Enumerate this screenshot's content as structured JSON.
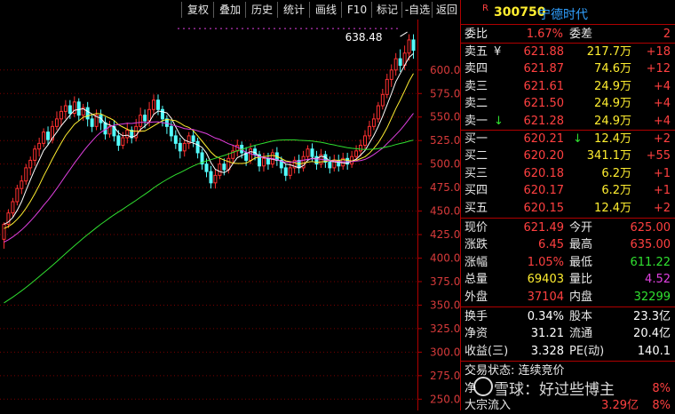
{
  "toolbar": {
    "buttons": [
      "复权",
      "叠加",
      "历史",
      "统计",
      "画线",
      "F10",
      "标记",
      "-自选",
      "返回"
    ]
  },
  "header": {
    "badge": "R",
    "code": "300750",
    "name": "宁德时代"
  },
  "chart_data": {
    "type": "candlestick",
    "y_axis": {
      "ticks": [
        600.0,
        575.0,
        550.0,
        525.0,
        500.0,
        475.0,
        450.0,
        425.0,
        400.0,
        375.0,
        350.0,
        325.0,
        300.0,
        275.0,
        250.0
      ],
      "labels": [
        "600.0",
        "575.0",
        "550.0",
        "525.0",
        "500.0",
        "475.0",
        "450.0",
        "425.0",
        "400.0",
        "375.0",
        "350.0",
        "325.0",
        "300.0",
        "275.0",
        "250.0"
      ],
      "min": 238,
      "max": 648
    },
    "max_annotation": {
      "label": "638.48",
      "value": 638.48
    },
    "candles": [
      [
        420,
        436,
        410,
        438
      ],
      [
        436,
        448,
        432,
        452
      ],
      [
        448,
        460,
        444,
        464
      ],
      [
        460,
        474,
        456,
        478
      ],
      [
        474,
        482,
        468,
        488
      ],
      [
        482,
        496,
        478,
        500
      ],
      [
        496,
        504,
        488,
        508
      ],
      [
        504,
        516,
        498,
        520
      ],
      [
        516,
        522,
        508,
        528
      ],
      [
        522,
        534,
        518,
        538
      ],
      [
        534,
        526,
        520,
        540
      ],
      [
        526,
        540,
        522,
        546
      ],
      [
        540,
        548,
        536,
        556
      ],
      [
        548,
        556,
        540,
        562
      ],
      [
        556,
        562,
        548,
        568
      ],
      [
        562,
        554,
        548,
        568
      ],
      [
        554,
        566,
        550,
        572
      ],
      [
        566,
        552,
        546,
        570
      ],
      [
        552,
        560,
        546,
        564
      ],
      [
        560,
        548,
        540,
        566
      ],
      [
        548,
        540,
        534,
        552
      ],
      [
        540,
        552,
        536,
        558
      ],
      [
        552,
        544,
        536,
        558
      ],
      [
        544,
        532,
        526,
        550
      ],
      [
        532,
        540,
        528,
        546
      ],
      [
        540,
        530,
        524,
        546
      ],
      [
        530,
        520,
        514,
        536
      ],
      [
        520,
        528,
        516,
        534
      ],
      [
        528,
        536,
        522,
        544
      ],
      [
        536,
        528,
        522,
        540
      ],
      [
        528,
        540,
        524,
        548
      ],
      [
        540,
        552,
        534,
        560
      ],
      [
        552,
        546,
        538,
        558
      ],
      [
        546,
        558,
        540,
        566
      ],
      [
        558,
        568,
        552,
        574
      ],
      [
        568,
        558,
        552,
        574
      ],
      [
        558,
        548,
        540,
        562
      ],
      [
        548,
        540,
        532,
        552
      ],
      [
        540,
        530,
        524,
        546
      ],
      [
        530,
        522,
        516,
        536
      ],
      [
        522,
        514,
        506,
        528
      ],
      [
        514,
        522,
        508,
        526
      ],
      [
        522,
        530,
        516,
        534
      ],
      [
        530,
        524,
        518,
        536
      ],
      [
        524,
        512,
        506,
        528
      ],
      [
        512,
        500,
        494,
        516
      ],
      [
        500,
        492,
        486,
        506
      ],
      [
        492,
        480,
        474,
        498
      ],
      [
        480,
        488,
        474,
        494
      ],
      [
        488,
        500,
        484,
        506
      ],
      [
        500,
        494,
        488,
        506
      ],
      [
        494,
        506,
        490,
        512
      ],
      [
        506,
        514,
        500,
        520
      ],
      [
        514,
        520,
        508,
        526
      ],
      [
        520,
        512,
        506,
        524
      ],
      [
        512,
        504,
        498,
        518
      ],
      [
        504,
        516,
        500,
        522
      ],
      [
        516,
        510,
        504,
        520
      ],
      [
        510,
        498,
        492,
        514
      ],
      [
        498,
        506,
        492,
        512
      ],
      [
        506,
        500,
        494,
        512
      ],
      [
        500,
        512,
        496,
        516
      ],
      [
        512,
        504,
        498,
        518
      ],
      [
        504,
        496,
        490,
        508
      ],
      [
        496,
        488,
        482,
        500
      ],
      [
        488,
        496,
        484,
        502
      ],
      [
        496,
        504,
        490,
        508
      ],
      [
        504,
        496,
        490,
        510
      ],
      [
        496,
        508,
        492,
        514
      ],
      [
        508,
        516,
        504,
        520
      ],
      [
        516,
        508,
        502,
        522
      ],
      [
        508,
        500,
        494,
        514
      ],
      [
        500,
        510,
        496,
        516
      ],
      [
        510,
        502,
        496,
        514
      ],
      [
        502,
        496,
        490,
        508
      ],
      [
        496,
        504,
        492,
        510
      ],
      [
        504,
        498,
        492,
        510
      ],
      [
        498,
        506,
        494,
        512
      ],
      [
        506,
        500,
        494,
        512
      ],
      [
        500,
        508,
        496,
        514
      ],
      [
        508,
        514,
        504,
        520
      ],
      [
        514,
        520,
        508,
        526
      ],
      [
        520,
        530,
        516,
        536
      ],
      [
        530,
        540,
        526,
        546
      ],
      [
        540,
        548,
        536,
        554
      ],
      [
        548,
        562,
        544,
        566
      ],
      [
        562,
        574,
        558,
        580
      ],
      [
        574,
        590,
        570,
        596
      ],
      [
        590,
        600,
        582,
        606
      ],
      [
        600,
        612,
        594,
        618
      ],
      [
        612,
        605,
        598,
        622
      ],
      [
        605,
        618,
        600,
        626
      ],
      [
        618,
        632,
        610,
        638
      ],
      [
        632,
        621,
        612,
        638
      ]
    ],
    "ma_lines": [
      {
        "name": "MA5",
        "color": "#ffffff"
      },
      {
        "name": "MA10",
        "color": "#ffee30"
      },
      {
        "name": "MA20",
        "color": "#e040e0"
      },
      {
        "name": "MA60",
        "color": "#30e030"
      }
    ]
  },
  "quote": {
    "webi": {
      "label": "委比",
      "value": "1.67%",
      "label2": "委差",
      "value2": "2"
    },
    "asks": [
      {
        "label": "卖五",
        "mark": "¥",
        "price": "621.88",
        "vol": "217.7万",
        "chg": "+18"
      },
      {
        "label": "卖四",
        "mark": "",
        "price": "621.87",
        "vol": "74.6万",
        "chg": "+12"
      },
      {
        "label": "卖三",
        "mark": "",
        "price": "621.61",
        "vol": "24.9万",
        "chg": "+4"
      },
      {
        "label": "卖二",
        "mark": "",
        "price": "621.50",
        "vol": "24.9万",
        "chg": "+4"
      },
      {
        "label": "卖一",
        "mark": "↓",
        "price": "621.28",
        "vol": "24.9万",
        "chg": "+4"
      }
    ],
    "bids": [
      {
        "label": "买一",
        "mark": "↓",
        "price": "620.21",
        "vol": "12.4万",
        "chg": "+2"
      },
      {
        "label": "买二",
        "mark": "",
        "price": "620.20",
        "vol": "341.1万",
        "chg": "+55"
      },
      {
        "label": "买三",
        "mark": "",
        "price": "620.18",
        "vol": "6.2万",
        "chg": "+1"
      },
      {
        "label": "买四",
        "mark": "",
        "price": "620.17",
        "vol": "6.2万",
        "chg": "+1"
      },
      {
        "label": "买五",
        "mark": "",
        "price": "620.15",
        "vol": "12.4万",
        "chg": "+2"
      }
    ],
    "stats": [
      {
        "l1": "现价",
        "v1": "621.49",
        "c1": "red",
        "l2": "今开",
        "v2": "625.00",
        "c2": "red"
      },
      {
        "l1": "涨跌",
        "v1": "6.45",
        "c1": "red",
        "l2": "最高",
        "v2": "635.00",
        "c2": "red"
      },
      {
        "l1": "涨幅",
        "v1": "1.05%",
        "c1": "red",
        "l2": "最低",
        "v2": "611.22",
        "c2": "grn"
      },
      {
        "l1": "总量",
        "v1": "69403",
        "c1": "yel",
        "l2": "量比",
        "v2": "4.52",
        "c2": "mag"
      },
      {
        "l1": "外盘",
        "v1": "37104",
        "c1": "red",
        "l2": "内盘",
        "v2": "32299",
        "c2": "grn"
      }
    ],
    "fund": [
      {
        "l1": "换手",
        "v1": "0.34%",
        "l2": "股本",
        "v2": "23.3亿"
      },
      {
        "l1": "净资",
        "v1": "31.21",
        "l2": "流通",
        "v2": "20.4亿"
      },
      {
        "l1": "收益(三)",
        "v1": "3.328",
        "l2": "PE(动)",
        "v2": "140.1"
      }
    ],
    "trade_status": "交易状态: 连续竞价",
    "bottom": [
      {
        "label": "净",
        "value": "8%"
      },
      {
        "label": "大宗流入",
        "value": "3.29亿",
        "pct": "8%"
      }
    ]
  },
  "watermark": "雪球：好过些博主"
}
